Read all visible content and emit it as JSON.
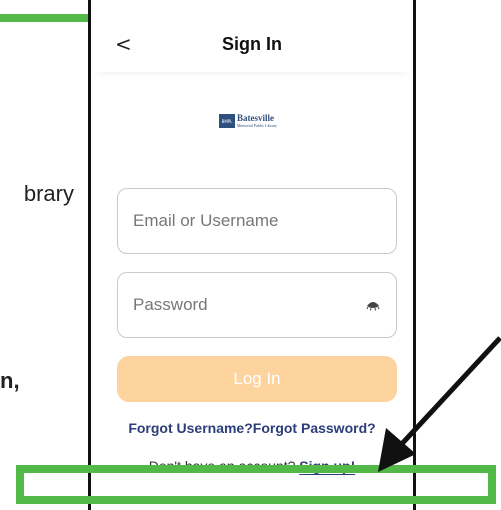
{
  "background": {
    "text_partial_1": "brary",
    "text_partial_2": "n,"
  },
  "header": {
    "back_icon": "<",
    "title": "Sign In"
  },
  "logo": {
    "badge": "BMPL",
    "name": "Batesville",
    "subtitle": "Memorial Public Library"
  },
  "form": {
    "email_placeholder": "Email or Username",
    "password_placeholder": "Password",
    "login_label": "Log In"
  },
  "links": {
    "forgot_username": "Forgot Username?",
    "forgot_password": "Forgot Password?"
  },
  "signup": {
    "prompt": "Don't have an account?",
    "link": "Sign up!"
  },
  "colors": {
    "highlight": "#52b848",
    "accent_link": "#2c3e7a",
    "login_button": "#fdd39e"
  }
}
